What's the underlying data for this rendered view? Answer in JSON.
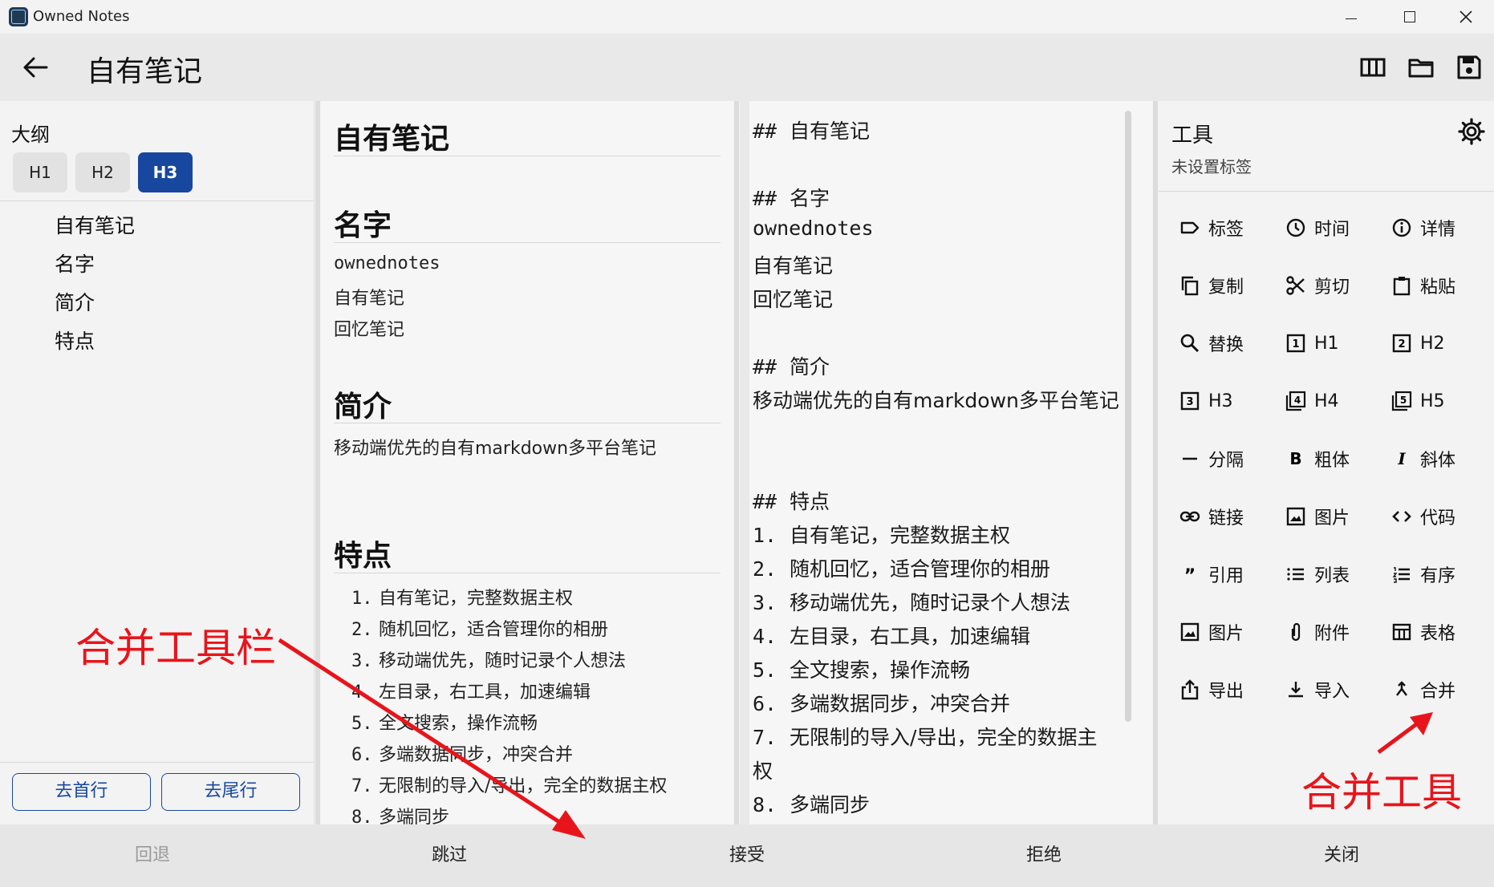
{
  "window": {
    "app_title": "Owned Notes"
  },
  "header": {
    "title": "自有笔记"
  },
  "outline": {
    "title": "大纲",
    "levels": [
      "H1",
      "H2",
      "H3"
    ],
    "selected_level": "H3",
    "items": [
      "自有笔记",
      "名字",
      "简介",
      "特点"
    ],
    "go_first": "去首行",
    "go_last": "去尾行"
  },
  "preview": {
    "h_title": "自有笔记",
    "h_name": "名字",
    "name_lines": [
      "ownednotes",
      "自有笔记",
      "回忆笔记"
    ],
    "h_intro": "简介",
    "intro_text": "移动端优先的自有markdown多平台笔记",
    "h_features": "特点",
    "features": [
      {
        "num": "1.",
        "text": "自有笔记，完整数据主权"
      },
      {
        "num": "2.",
        "text": "随机回忆，适合管理你的相册"
      },
      {
        "num": "3.",
        "text": "移动端优先，随时记录个人想法"
      },
      {
        "num": "4.",
        "text": "左目录，右工具，加速编辑"
      },
      {
        "num": "5.",
        "text": "全文搜索，操作流畅"
      },
      {
        "num": "6.",
        "text": "多端数据同步，冲突合并"
      },
      {
        "num": "7.",
        "text": "无限制的导入/导出，完全的数据主权"
      },
      {
        "num": "8.",
        "text": "多端同步"
      }
    ]
  },
  "source": {
    "lines": [
      {
        "mark": "##",
        "text": "自有笔记"
      },
      {
        "mark": "##",
        "text": "名字"
      },
      {
        "mark": "",
        "text": "ownednotes"
      },
      {
        "mark": "",
        "text": "自有笔记"
      },
      {
        "mark": "",
        "text": "回忆笔记"
      },
      {
        "mark": "##",
        "text": "简介"
      },
      {
        "mark": "",
        "text": "移动端优先的自有markdown多平台笔记"
      },
      {
        "mark": "##",
        "text": "特点"
      },
      {
        "mark": "1.",
        "text": "自有笔记，完整数据主权"
      },
      {
        "mark": "2.",
        "text": "随机回忆，适合管理你的相册"
      },
      {
        "mark": "3.",
        "text": "移动端优先，随时记录个人想法"
      },
      {
        "mark": "4.",
        "text": "左目录，右工具，加速编辑"
      },
      {
        "mark": "5.",
        "text": "全文搜索，操作流畅"
      },
      {
        "mark": "6.",
        "text": "多端数据同步，冲突合并"
      },
      {
        "mark": "7.",
        "text": "无限制的导入/导出，完全的数据主"
      },
      {
        "mark": "",
        "text": "权"
      },
      {
        "mark": "8.",
        "text": "多端同步"
      }
    ]
  },
  "tools": {
    "title": "工具",
    "subtitle": "未设置标签",
    "items": [
      {
        "icon": "tag-icon",
        "label": "标签"
      },
      {
        "icon": "clock-icon",
        "label": "时间"
      },
      {
        "icon": "info-icon",
        "label": "详情"
      },
      {
        "icon": "copy-icon",
        "label": "复制"
      },
      {
        "icon": "scissors-icon",
        "label": "剪切"
      },
      {
        "icon": "clipboard-icon",
        "label": "粘贴"
      },
      {
        "icon": "search-icon",
        "label": "替换"
      },
      {
        "icon": "h1-icon",
        "label": "H1"
      },
      {
        "icon": "h2-icon",
        "label": "H2"
      },
      {
        "icon": "h3-icon",
        "label": "H3"
      },
      {
        "icon": "h4-icon",
        "label": "H4"
      },
      {
        "icon": "h5-icon",
        "label": "H5"
      },
      {
        "icon": "divider-icon",
        "label": "分隔"
      },
      {
        "icon": "bold-icon",
        "label": "粗体"
      },
      {
        "icon": "italic-icon",
        "label": "斜体"
      },
      {
        "icon": "link-icon",
        "label": "链接"
      },
      {
        "icon": "image-icon",
        "label": "图片"
      },
      {
        "icon": "code-icon",
        "label": "代码"
      },
      {
        "icon": "quote-icon",
        "label": "引用"
      },
      {
        "icon": "list-icon",
        "label": "列表"
      },
      {
        "icon": "ordered-list-icon",
        "label": "有序"
      },
      {
        "icon": "image-icon",
        "label": "图片"
      },
      {
        "icon": "paperclip-icon",
        "label": "附件"
      },
      {
        "icon": "table-icon",
        "label": "表格"
      },
      {
        "icon": "export-icon",
        "label": "导出"
      },
      {
        "icon": "import-icon",
        "label": "导入"
      },
      {
        "icon": "merge-icon",
        "label": "合并"
      }
    ]
  },
  "actions": {
    "undo": "回退",
    "skip": "跳过",
    "accept": "接受",
    "reject": "拒绝",
    "close": "关闭"
  },
  "annotations": {
    "merge_toolbar": "合并工具栏",
    "merge_tool": "合并工具",
    "color": "#e8141b"
  },
  "colors": {
    "accent": "#17479e"
  }
}
